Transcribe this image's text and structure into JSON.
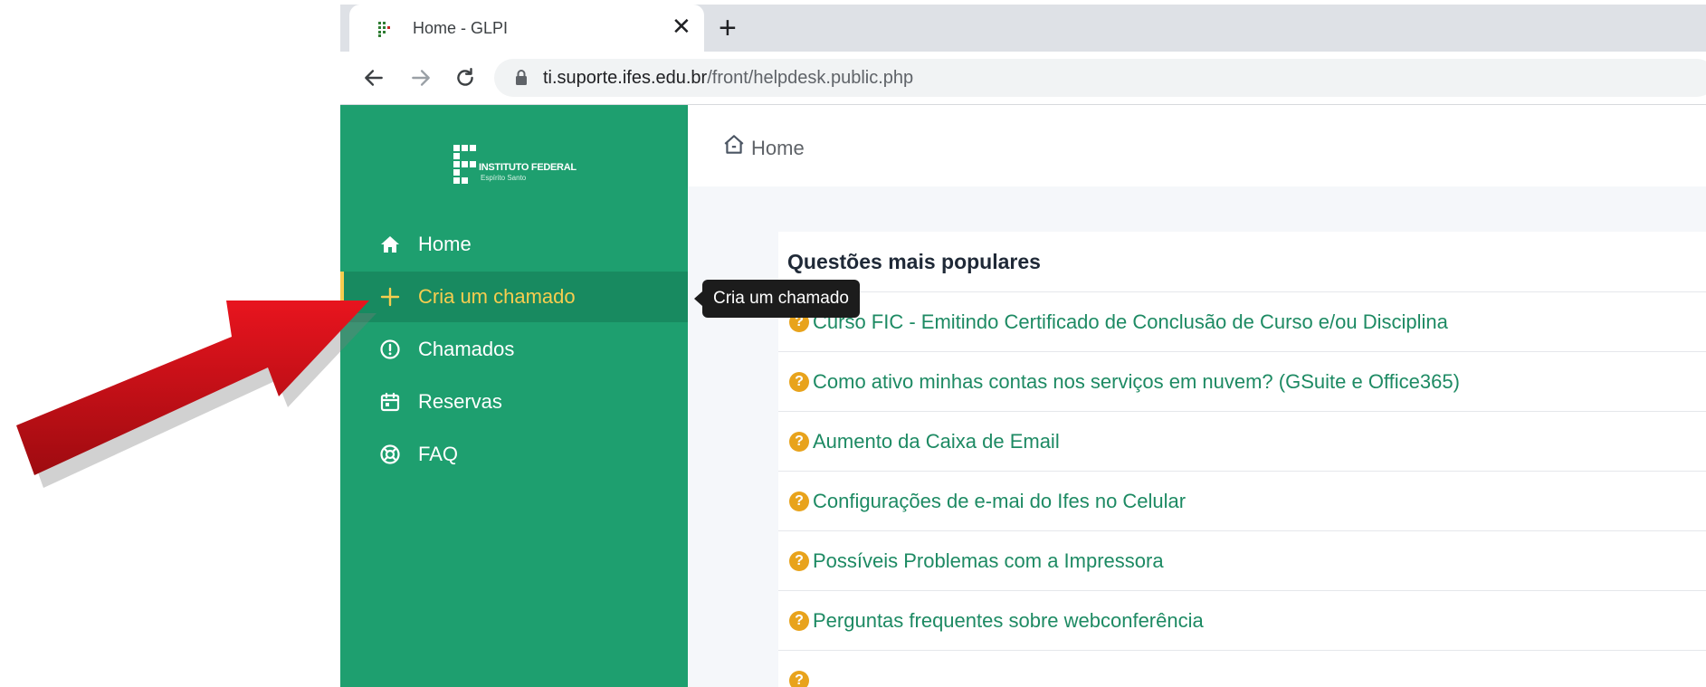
{
  "browser": {
    "tab_title": "Home - GLPI",
    "tab_close": "✕",
    "new_tab": "+",
    "url_host": "ti.suporte.ifes.edu.br",
    "url_path": "/front/helpdesk.public.php"
  },
  "logo": {
    "line1": "INSTITUTO FEDERAL",
    "line2": "Espírito Santo"
  },
  "sidebar": {
    "items": [
      {
        "label": "Home",
        "icon": "home-icon"
      },
      {
        "label": "Cria um chamado",
        "icon": "plus-icon"
      },
      {
        "label": "Chamados",
        "icon": "alert-circle-icon"
      },
      {
        "label": "Reservas",
        "icon": "calendar-icon"
      },
      {
        "label": "FAQ",
        "icon": "lifebuoy-icon"
      }
    ]
  },
  "breadcrumb": {
    "label": "Home"
  },
  "tooltip": {
    "text": "Cria um chamado"
  },
  "faq": {
    "title": "Questões mais populares",
    "icon_glyph": "?",
    "questions": [
      "Curso FIC - Emitindo Certificado de Conclusão de Curso e/ou Disciplina",
      "Como ativo minhas contas nos serviços em nuvem? (GSuite e Office365)",
      "Aumento da Caixa de Email",
      "Configurações de e-mai do Ifes no Celular",
      "Possíveis Problemas com a Impressora",
      "Perguntas frequentes sobre webconferência"
    ]
  },
  "colors": {
    "sidebar_green": "#1e9f6f",
    "active_yellow": "#f7cd4f",
    "link_green": "#1d8a63",
    "annotation_red": "#d0121b"
  }
}
